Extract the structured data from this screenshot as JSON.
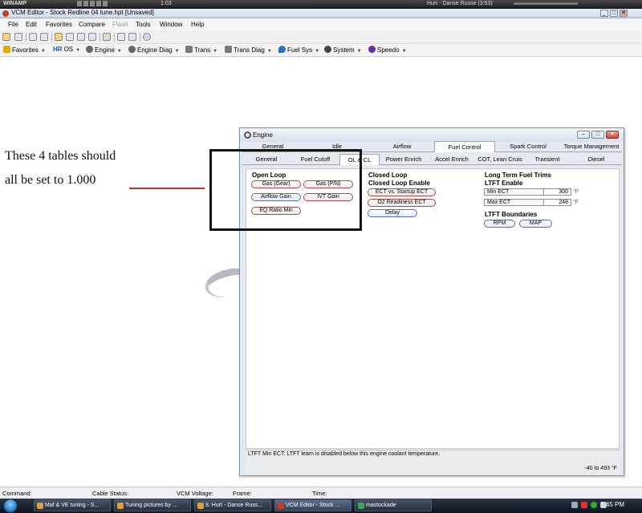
{
  "winamp": {
    "title": "WINAMP",
    "time": "1:03",
    "track": "Hurt - Danse Russe (3:53)"
  },
  "window": {
    "title": "VCM Editor - Stock Redline 04 tune.hpt   [Unsaved]",
    "min": "_",
    "max": "□",
    "close": "✕"
  },
  "menu": [
    "File",
    "Edit",
    "Favorites",
    "Compare",
    "Flash",
    "Tools",
    "Window",
    "Help"
  ],
  "navbar": [
    {
      "label": "Favorites",
      "icon": "star-icon",
      "color": "#e0a800"
    },
    {
      "label": "OS",
      "prefix": "HR",
      "icon": "os-icon",
      "color": "#2255aa"
    },
    {
      "label": "Engine",
      "icon": "engine-icon",
      "color": "#555555"
    },
    {
      "label": "Engine Diag",
      "icon": "engine-diag-icon",
      "color": "#555555"
    },
    {
      "label": "Trans",
      "icon": "trans-icon",
      "color": "#555555"
    },
    {
      "label": "Trans Diag",
      "icon": "trans-diag-icon",
      "color": "#555555"
    },
    {
      "label": "Fuel Sys",
      "icon": "fuel-drop-icon",
      "color": "#2a6fd0"
    },
    {
      "label": "System",
      "icon": "system-icon",
      "color": "#444444"
    },
    {
      "label": "Speedo",
      "icon": "speedo-icon",
      "color": "#6a2ab0"
    }
  ],
  "annotation": {
    "line1": "These 4 tables should",
    "line2": "all be set to 1.000"
  },
  "engine": {
    "title": "Engine",
    "tabs_row1": [
      "General",
      "Idle",
      "Airflow",
      "Fuel Control",
      "Spark Control",
      "Torque Management"
    ],
    "active_tab1": "Fuel Control",
    "tabs_row2": [
      "General",
      "Fuel Cutoff",
      "OL & CL",
      "Power Enrich",
      "Accel Enrich",
      "COT, Lean Cruis",
      "Transient",
      "Diesel"
    ],
    "active_tab2": "OL & CL",
    "open_loop": {
      "title": "Open Loop",
      "buttons": [
        "Gas (Gear)",
        "Gas (P/N)",
        "Airflow Gain",
        "IVT Gain",
        "EQ Ratio Min"
      ]
    },
    "closed_loop": {
      "title": "Closed Loop",
      "enable_title": "Closed Loop Enable",
      "buttons": [
        "ECT vs. Startup ECT",
        "O2 Readiness ECT",
        "Delay"
      ]
    },
    "ltft": {
      "title": "Long Term Fuel Trims",
      "enable_title": "LTFT Enable",
      "fields": [
        {
          "label": "Min ECT",
          "value": "300",
          "unit": "°F"
        },
        {
          "label": "Max ECT",
          "value": "248",
          "unit": "°F"
        }
      ],
      "boundaries_title": "LTFT Boundaries",
      "boundary_buttons": [
        "RPM",
        "MAP"
      ]
    },
    "status": {
      "description": "LTFT Min ECT: LTFT learn is disabled below this engine coolant temperature.",
      "range": "-40 to 493 °F"
    }
  },
  "statusbar": {
    "command": "Command:",
    "cable": "Cable Status:",
    "vcm_voltage": "VCM Voltage:",
    "frame": "Frame:",
    "time": "Time:"
  },
  "taskbar": {
    "tasks": [
      "Maf & VE tuning - S...",
      "Tuning pictures by ...",
      "8. Hurt - Danse Russ...",
      "VCM Editor - Stock ...",
      "mastockade"
    ],
    "active_task": "VCM Editor - Stock ...",
    "clock": "1:45 PM"
  }
}
